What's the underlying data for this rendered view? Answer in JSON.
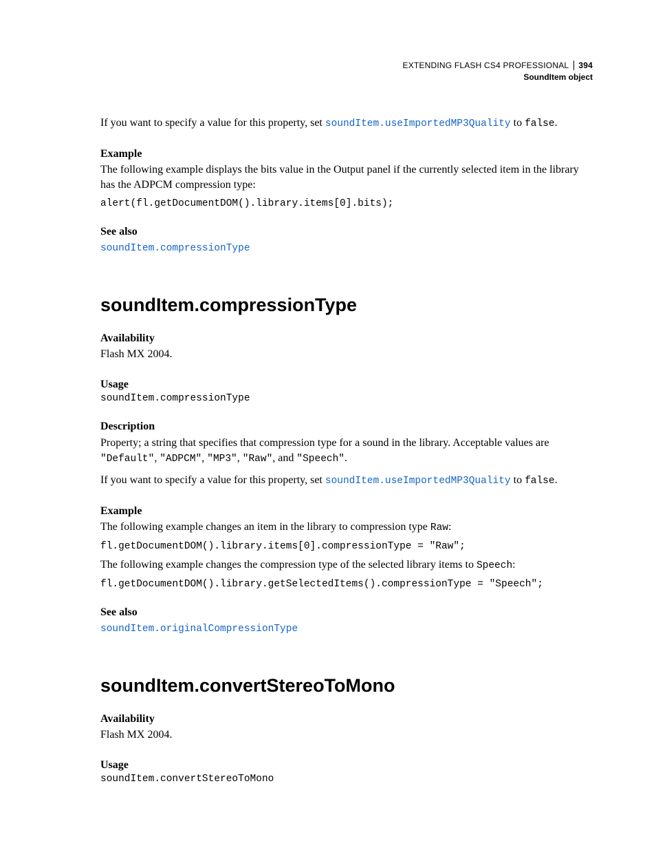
{
  "header": {
    "book_title": "EXTENDING FLASH CS4 PROFESSIONAL",
    "page_number": "394",
    "chapter": "SoundItem object"
  },
  "intro": {
    "specify_prefix": "If you want to specify a value for this property, set ",
    "specify_link": "soundItem.useImportedMP3Quality",
    "specify_mid": " to ",
    "specify_code": "false",
    "specify_suffix": ".",
    "example_head": "Example",
    "example_text": "The following example displays the bits value in the Output panel if the currently selected item in the library has the ADPCM compression type:",
    "example_code": "alert(fl.getDocumentDOM().library.items[0].bits);",
    "seealso_head": "See also",
    "seealso_link": "soundItem.compressionType"
  },
  "section1": {
    "title": "soundItem.compressionType",
    "availability_head": "Availability",
    "availability_text": "Flash MX 2004.",
    "usage_head": "Usage",
    "usage_code": "soundItem.compressionType",
    "description_head": "Description",
    "desc_p1_a": "Property; a string that specifies that compression type for a sound in the library. Acceptable values are ",
    "desc_c1": "\"Default\"",
    "desc_p1_b": ", ",
    "desc_c2": "\"ADPCM\"",
    "desc_p1_c": ", ",
    "desc_c3": "\"MP3\"",
    "desc_p1_d": ", ",
    "desc_c4": "\"Raw\"",
    "desc_p1_e": ", and ",
    "desc_c5": "\"Speech\"",
    "desc_p1_f": ".",
    "specify_prefix": "If you want to specify a value for this property, set ",
    "specify_link": "soundItem.useImportedMP3Quality",
    "specify_mid": " to ",
    "specify_code": "false",
    "specify_suffix": ".",
    "example_head": "Example",
    "ex_p1_a": "The following example changes an item in the library to compression type ",
    "ex_p1_code": "Raw",
    "ex_p1_b": ":",
    "ex_code1": "fl.getDocumentDOM().library.items[0].compressionType = \"Raw\";",
    "ex_p2_a": "The following example changes the compression type of the selected library items to ",
    "ex_p2_code": "Speech",
    "ex_p2_b": ":",
    "ex_code2": "fl.getDocumentDOM().library.getSelectedItems().compressionType = \"Speech\";",
    "seealso_head": "See also",
    "seealso_link": "soundItem.originalCompressionType"
  },
  "section2": {
    "title": "soundItem.convertStereoToMono",
    "availability_head": "Availability",
    "availability_text": "Flash MX 2004.",
    "usage_head": "Usage",
    "usage_code": "soundItem.convertStereoToMono"
  }
}
